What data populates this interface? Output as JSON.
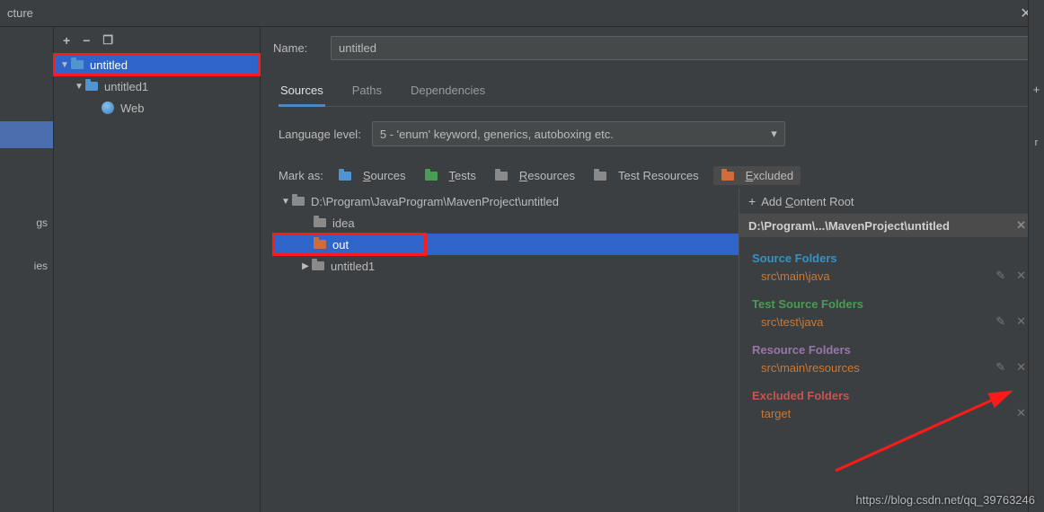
{
  "titlebar": {
    "title": "cture"
  },
  "leftStrip": {
    "item1": "gs",
    "item2": "ies"
  },
  "midTree": {
    "root": "untitled",
    "child1": "untitled1",
    "child1a": "Web"
  },
  "form": {
    "nameLabel": "Name:",
    "nameValue": "untitled",
    "tabs": {
      "sources": "Sources",
      "paths": "Paths",
      "deps": "Dependencies"
    },
    "langLabel": "Language level:",
    "langValue": "5 - 'enum' keyword, generics, autoboxing etc."
  },
  "markAs": {
    "label": "Mark as:",
    "sources": "Sources",
    "tests": "Tests",
    "resources": "Resources",
    "testResources": "Test Resources",
    "excluded": "Excluded"
  },
  "dirTree": {
    "root": "D:\\Program\\JavaProgram\\MavenProject\\untitled",
    "idea": "idea",
    "out": "out",
    "untitled1": "untitled1"
  },
  "side": {
    "addRoot": "Add Content Root",
    "rootPath": "D:\\Program\\...\\MavenProject\\untitled",
    "sourceTitle": "Source Folders",
    "sourceItem": "src\\main\\java",
    "testTitle": "Test Source Folders",
    "testItem": "src\\test\\java",
    "resourceTitle": "Resource Folders",
    "resourceItem": "src\\main\\resources",
    "excludedTitle": "Excluded Folders",
    "excludedItem": "target"
  },
  "watermark": "https://blog.csdn.net/qq_39763246"
}
